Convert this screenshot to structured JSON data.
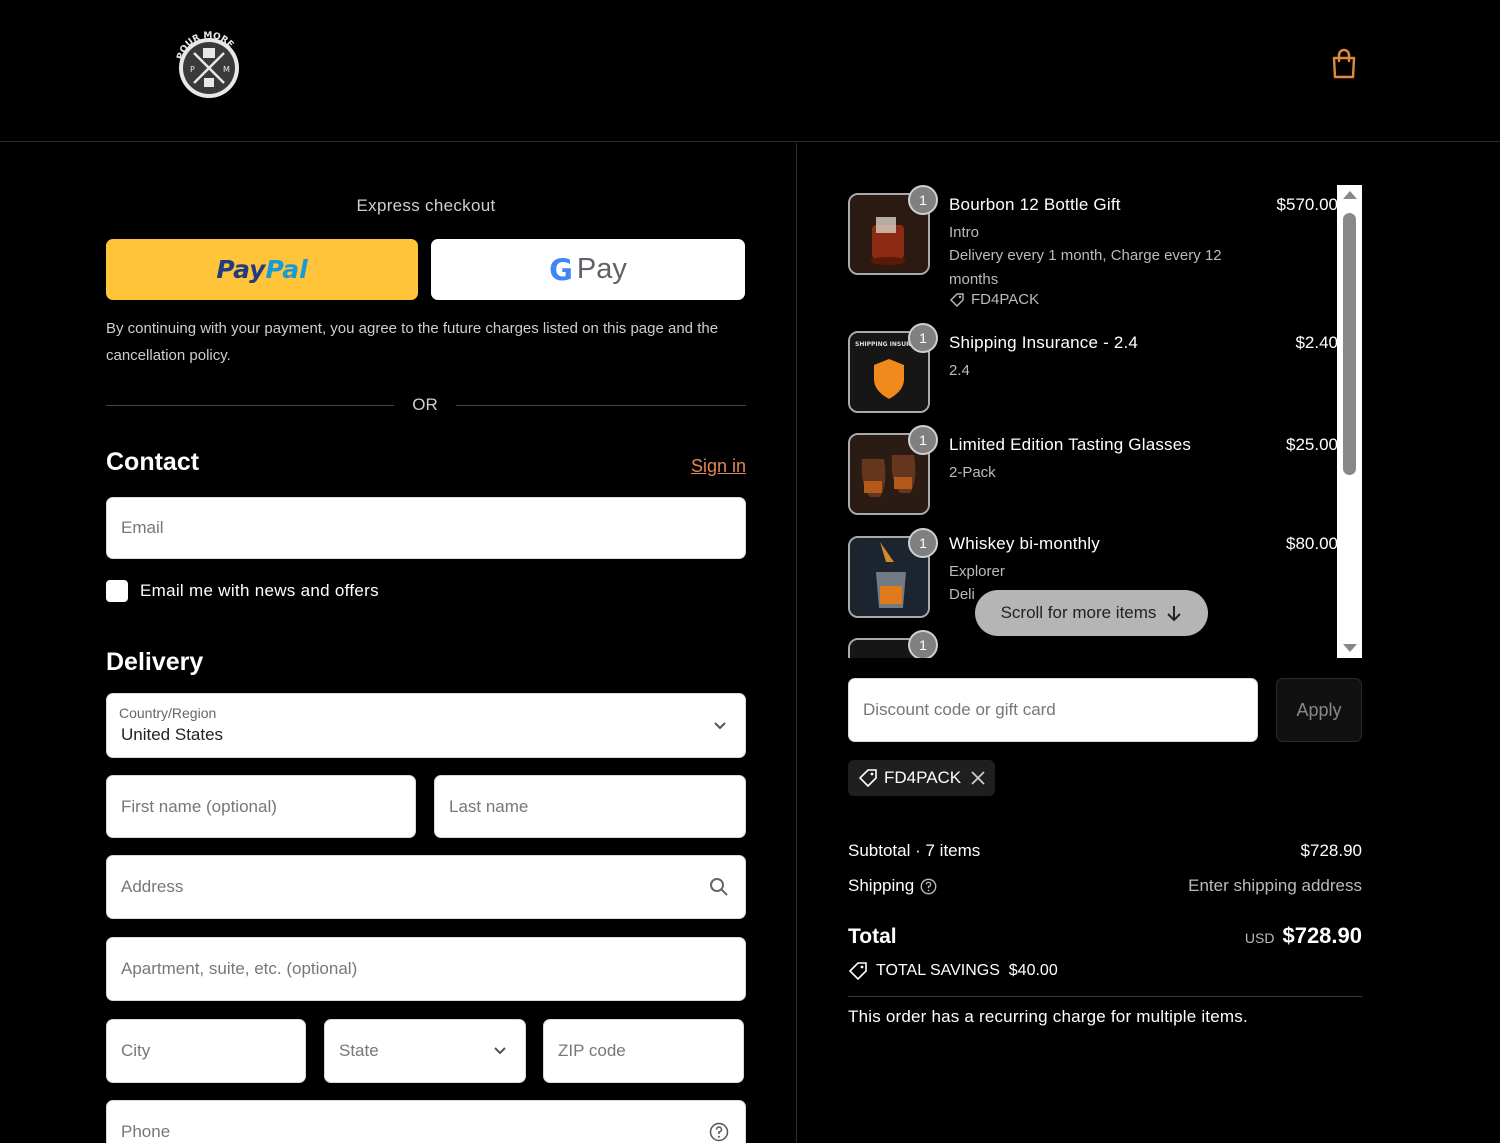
{
  "header": {
    "logo": {
      "top_text": "POUR MORE",
      "left_letter": "P",
      "right_letter": "M"
    },
    "cart_icon": "shopping-bag-icon"
  },
  "express": {
    "title": "Express checkout",
    "paypal": {
      "pay": "Pay",
      "pal": "Pal"
    },
    "gpay": {
      "g": "G",
      "pay": "Pay"
    },
    "consent": "By continuing with your payment, you agree to the future charges listed on this page and the cancellation policy.",
    "or": "OR"
  },
  "contact": {
    "title": "Contact",
    "sign_in": "Sign in",
    "email_placeholder": "Email",
    "newsletter_label": "Email me with news and offers"
  },
  "delivery": {
    "title": "Delivery",
    "country_label": "Country/Region",
    "country_value": "United States",
    "first_name_placeholder": "First name (optional)",
    "last_name_placeholder": "Last name",
    "address_placeholder": "Address",
    "apartment_placeholder": "Apartment, suite, etc. (optional)",
    "city_placeholder": "City",
    "state_placeholder": "State",
    "zip_placeholder": "ZIP code",
    "phone_placeholder": "Phone"
  },
  "cart": {
    "items": [
      {
        "qty": "1",
        "name": "Bourbon 12 Bottle Gift",
        "price": "$570.00",
        "lines": [
          "Intro",
          "Delivery every 1 month, Charge every 12 months"
        ],
        "code": "FD4PACK"
      },
      {
        "qty": "1",
        "name": "Shipping Insurance - 2.4",
        "price": "$2.40",
        "lines": [
          "2.4"
        ],
        "thumb_text": "SHIPPING INSURA"
      },
      {
        "qty": "1",
        "name": "Limited Edition Tasting Glasses",
        "price": "$25.00",
        "lines": [
          "2-Pack"
        ]
      },
      {
        "qty": "1",
        "name": "Whiskey bi-monthly",
        "price": "$80.00",
        "lines": [
          "Explorer",
          "Deli"
        ]
      },
      {
        "qty": "1"
      }
    ],
    "scroll_hint": "Scroll for more items"
  },
  "discount": {
    "placeholder": "Discount code or gift card",
    "apply": "Apply",
    "applied_code": "FD4PACK"
  },
  "summary": {
    "subtotal_label": "Subtotal · 7 items",
    "subtotal_value": "$728.90",
    "shipping_label": "Shipping",
    "shipping_value": "Enter shipping address",
    "total_label": "Total",
    "currency": "USD",
    "total_value": "$728.90",
    "savings": "TOTAL SAVINGS  $40.00",
    "recurring_note": "This order has a recurring charge for multiple items."
  },
  "colors": {
    "background": "#000000",
    "paypal_yellow": "#ffc439",
    "link_accent": "#e0875a",
    "cart_accent": "#e08a3c"
  }
}
